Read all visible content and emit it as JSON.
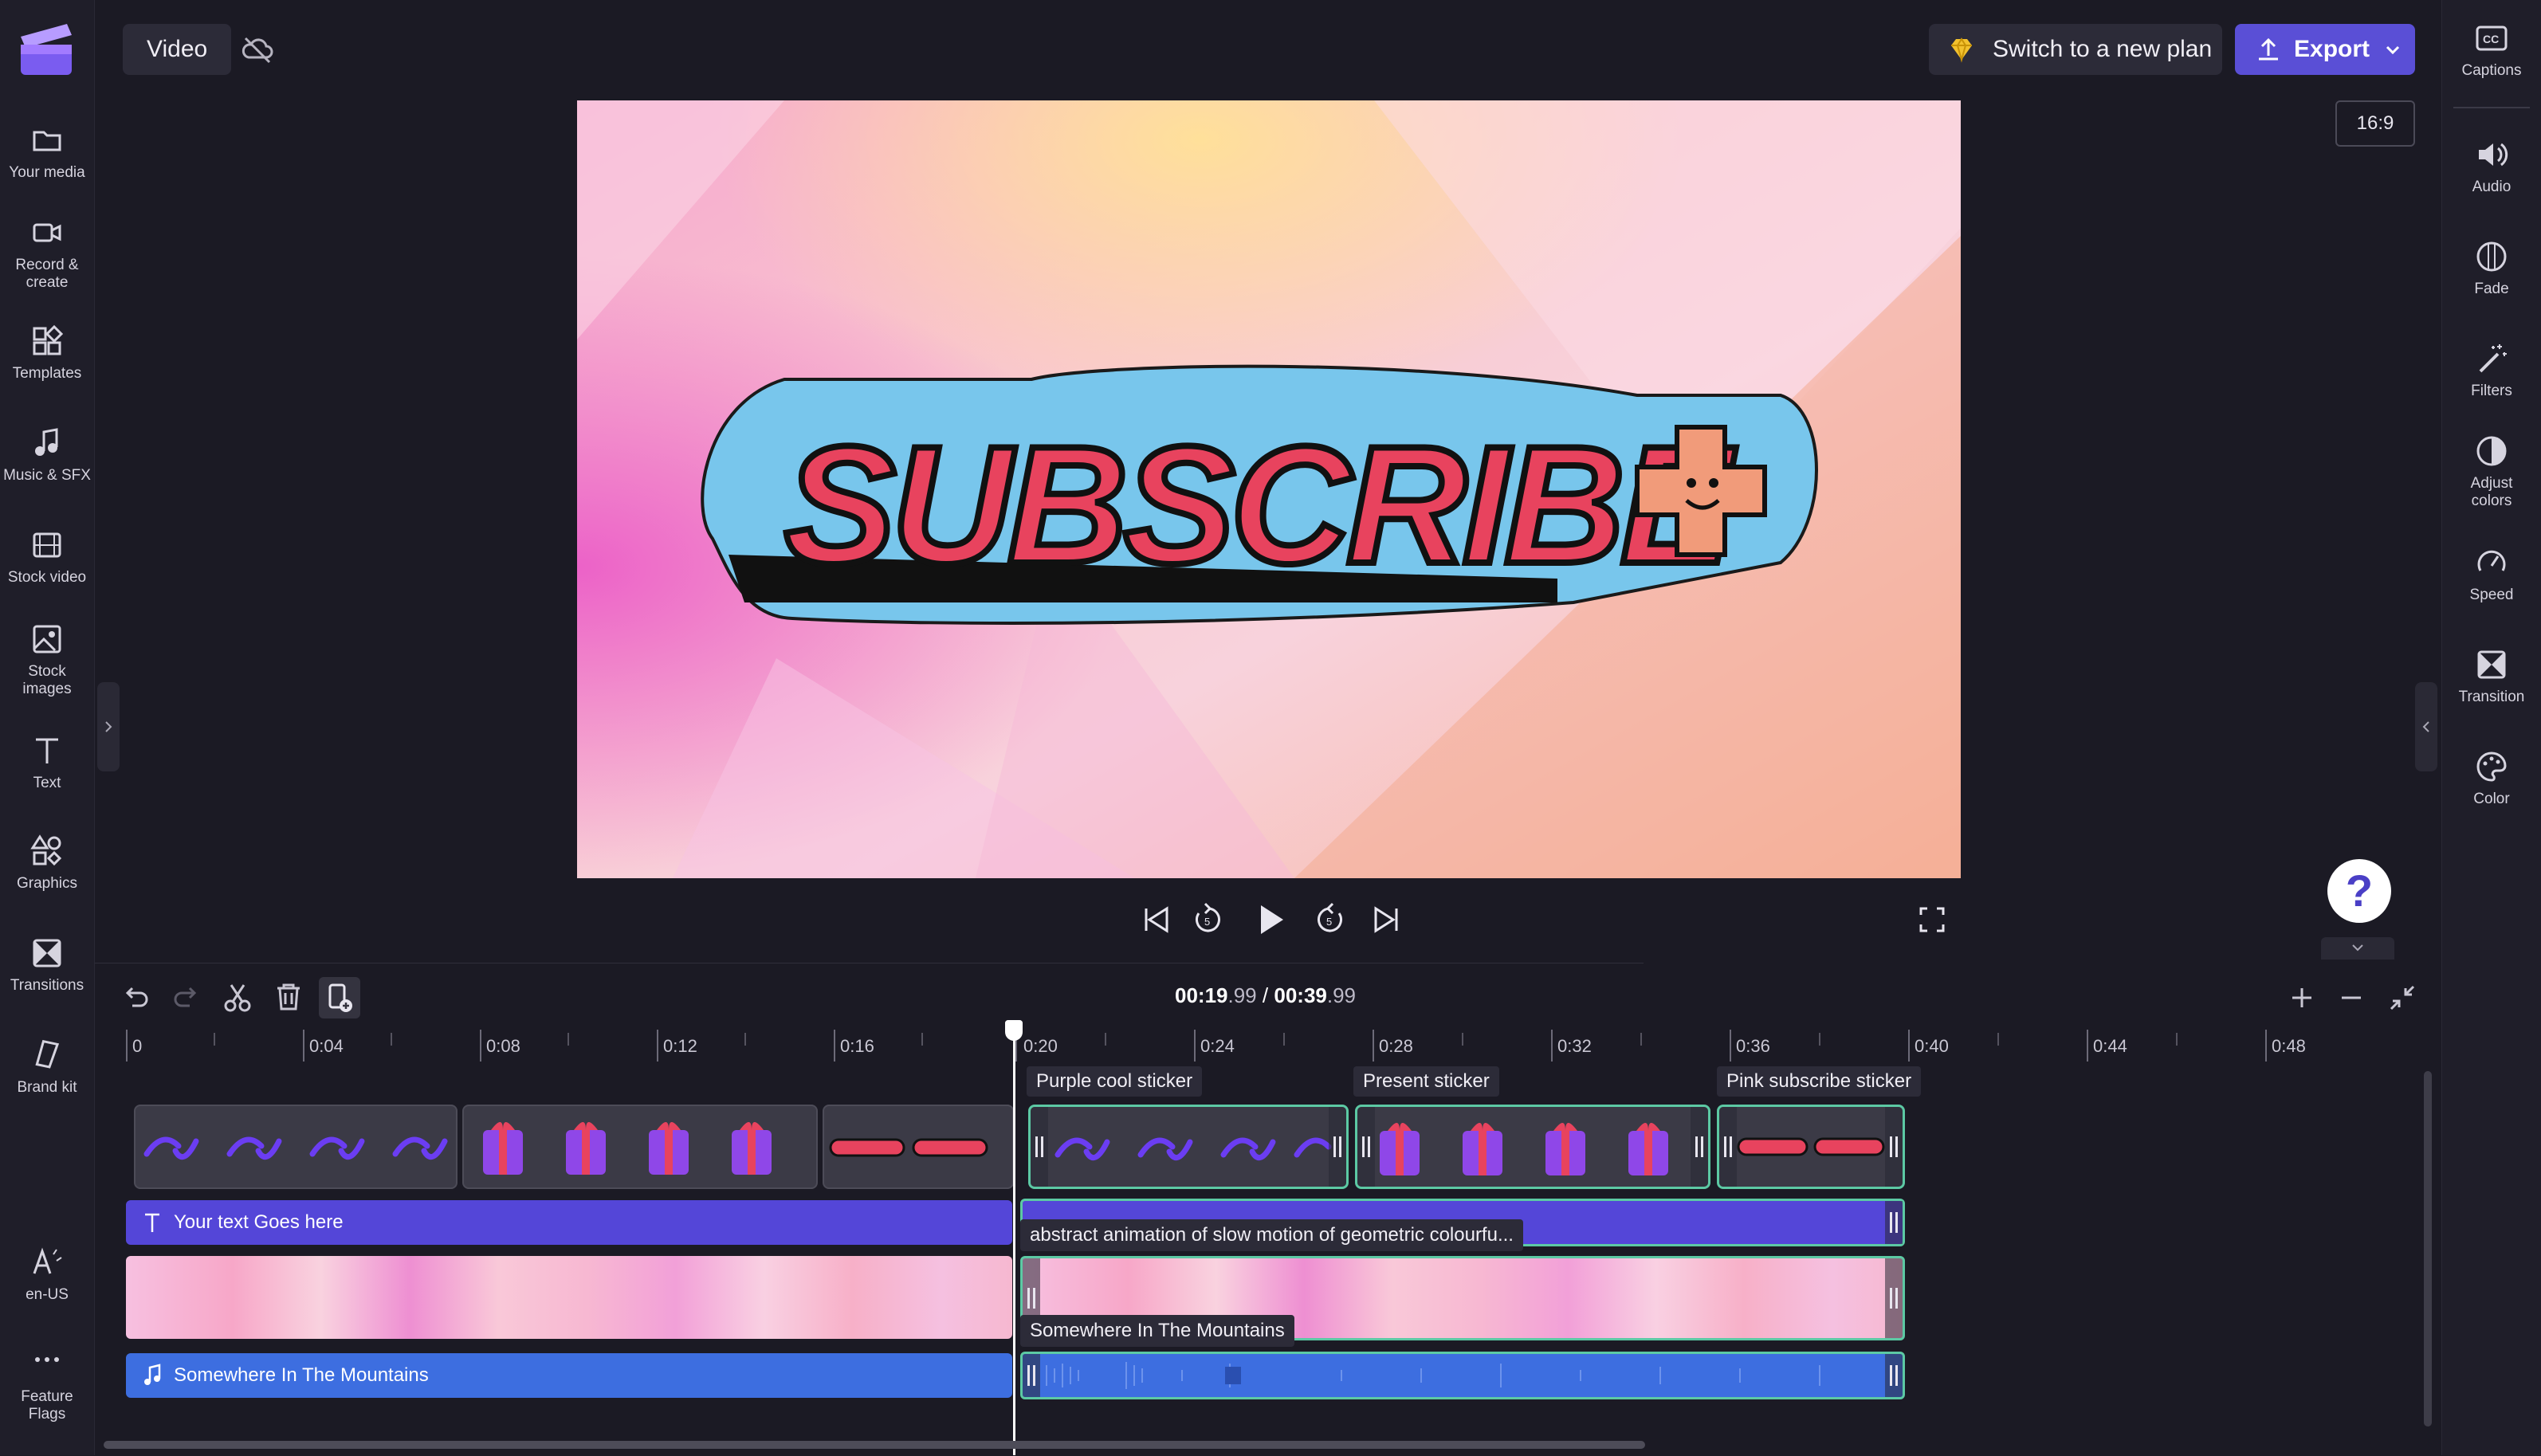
{
  "app": {
    "project_tab": "Video"
  },
  "left_nav": [
    {
      "label": "Your media",
      "icon": "folder-icon"
    },
    {
      "label": "Record & create",
      "icon": "camera-icon"
    },
    {
      "label": "Templates",
      "icon": "templates-icon"
    },
    {
      "label": "Music & SFX",
      "icon": "music-note-icon"
    },
    {
      "label": "Stock video",
      "icon": "film-icon"
    },
    {
      "label": "Stock images",
      "icon": "image-icon"
    },
    {
      "label": "Text",
      "icon": "text-icon"
    },
    {
      "label": "Graphics",
      "icon": "shapes-icon"
    },
    {
      "label": "Transitions",
      "icon": "transition-icon"
    },
    {
      "label": "Brand kit",
      "icon": "brand-kit-icon"
    },
    {
      "label": "en-US",
      "icon": "language-icon"
    },
    {
      "label": "Feature Flags",
      "icon": "more-icon"
    }
  ],
  "right_nav": [
    {
      "label": "Captions",
      "icon": "captions-icon"
    },
    {
      "label": "Audio",
      "icon": "speaker-icon"
    },
    {
      "label": "Fade",
      "icon": "fade-icon"
    },
    {
      "label": "Filters",
      "icon": "magic-wand-icon"
    },
    {
      "label": "Adjust colors",
      "icon": "contrast-icon"
    },
    {
      "label": "Speed",
      "icon": "speedometer-icon"
    },
    {
      "label": "Transition",
      "icon": "transition-icon"
    },
    {
      "label": "Color",
      "icon": "palette-icon"
    }
  ],
  "header": {
    "plan_button": "Switch to a new plan",
    "export_button": "Export",
    "aspect_ratio": "16:9"
  },
  "preview": {
    "sticker_text": "SUBSCRIBE"
  },
  "timeline": {
    "current_time": "00:19",
    "current_frames": ".99",
    "separator": "/",
    "total_time": "00:39",
    "total_frames": ".99",
    "ruler": [
      "0",
      "0:04",
      "0:08",
      "0:12",
      "0:16",
      "0:20",
      "0:24",
      "0:28",
      "0:32",
      "0:36",
      "0:40",
      "0:44",
      "0:48"
    ],
    "clip_labels": {
      "purple": "Purple cool sticker",
      "present": "Present sticker",
      "pink": "Pink subscribe sticker",
      "video": "abstract animation of slow motion of geometric colourfu...",
      "audio": "Somewhere In The Mountains"
    },
    "text_track": "Your text Goes here",
    "audio_track": "Somewhere In The Mountains"
  },
  "colors": {
    "accent": "#5a4fd6",
    "selection": "#5cc9a4",
    "text_track": "#5446d8",
    "audio_track": "#3d6ee0"
  }
}
